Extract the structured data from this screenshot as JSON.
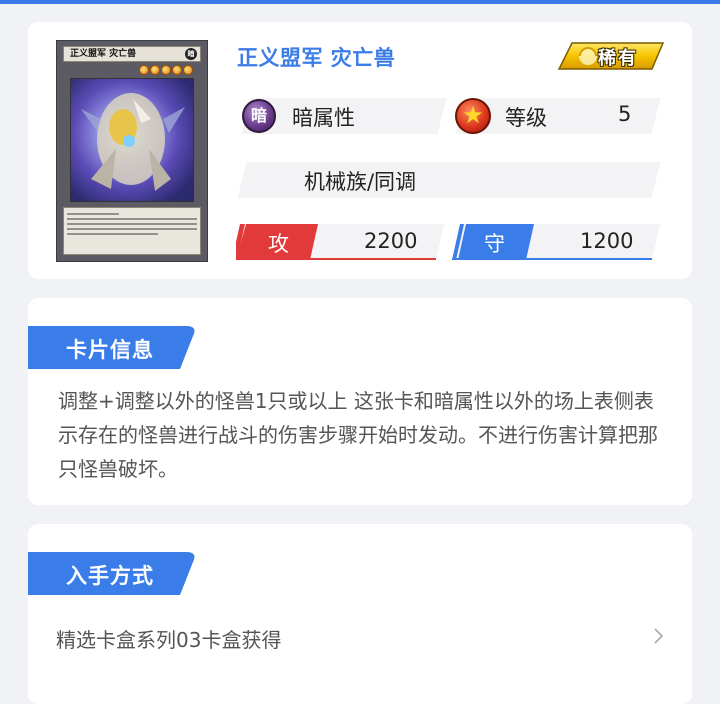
{
  "card": {
    "name": "正义盟军 灾亡兽",
    "rarity": "稀有",
    "attribute_icon": "暗",
    "attribute": "暗属性",
    "level_label": "等级",
    "level": "5",
    "type": "机械族/同调",
    "atk_label": "攻",
    "atk": "2200",
    "def_label": "守",
    "def": "1200",
    "image": {
      "name_line": "正义盟军 灾亡兽",
      "attribute_mini": "暗",
      "star_count": 5,
      "icon": "card-artwork-image"
    }
  },
  "sections": {
    "info": {
      "title": "卡片信息",
      "description": "调整+调整以外的怪兽1只或以上 这张卡和暗属性以外的场上表侧表示存在的怪兽进行战斗的伤害步骤开始时发动。不进行伤害计算把那只怪兽破坏。"
    },
    "obtain": {
      "title": "入手方式",
      "method": "精选卡盒系列03卡盒获得"
    }
  },
  "colors": {
    "accent": "#3b7de8",
    "atk": "#e83a3a",
    "def": "#3b7de8",
    "rarity_gold": "#f5c400"
  },
  "icons": {
    "attribute": "dark-attribute-icon",
    "level": "level-star-icon",
    "chevron": "chevron-right-icon"
  }
}
